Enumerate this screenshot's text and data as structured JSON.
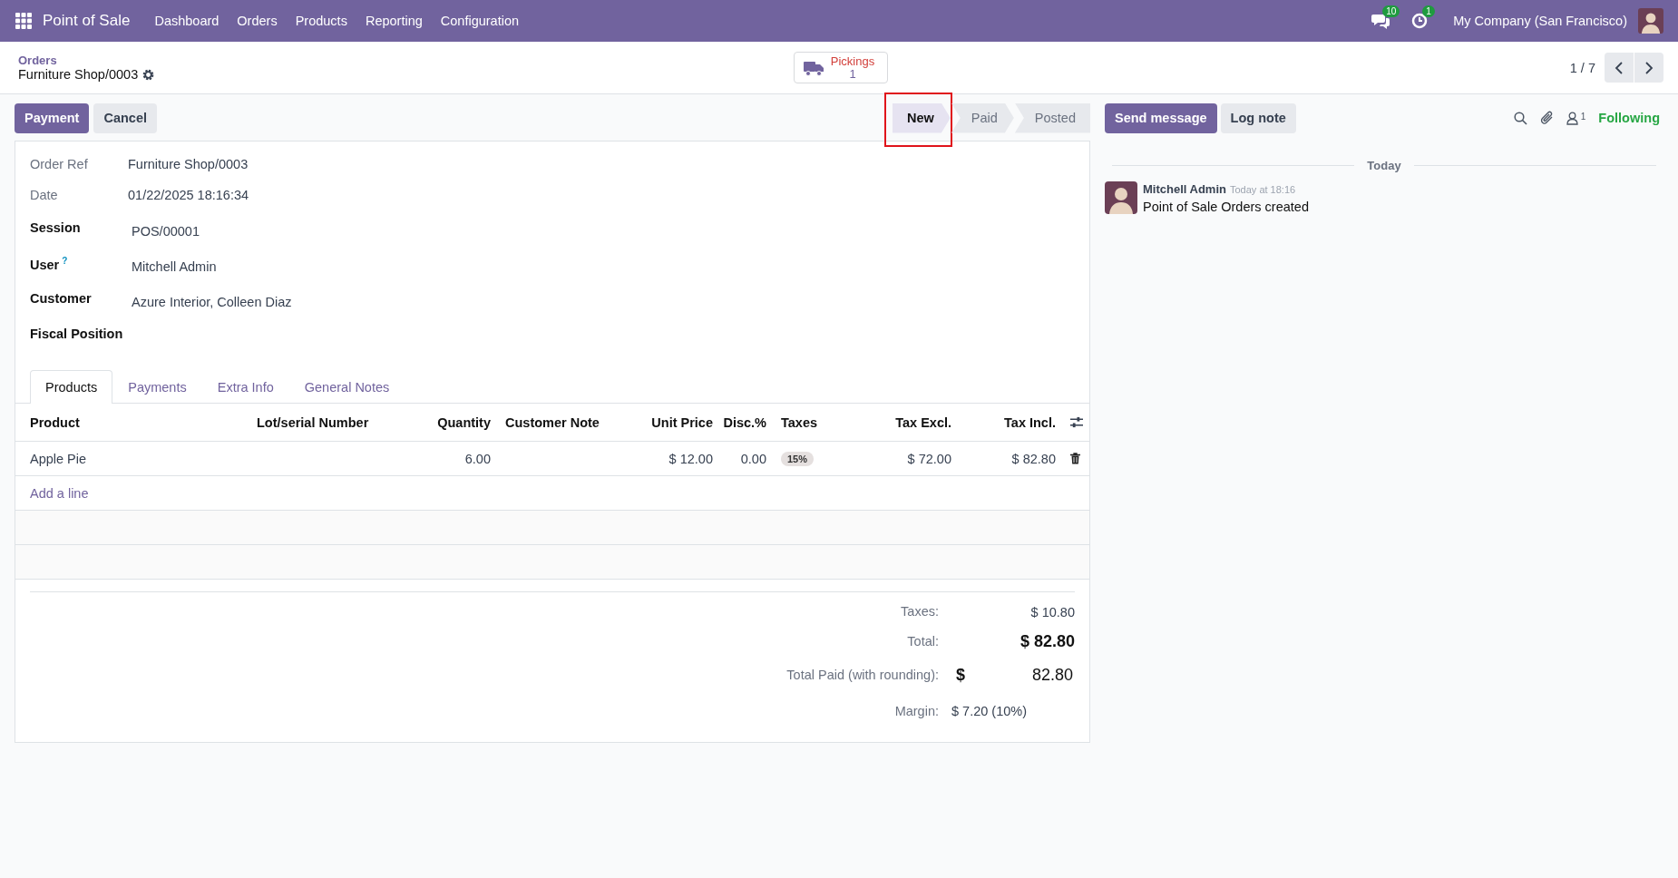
{
  "navbar": {
    "app_title": "Point of Sale",
    "menu": [
      "Dashboard",
      "Orders",
      "Products",
      "Reporting",
      "Configuration"
    ],
    "messages_badge": "10",
    "activities_badge": "1",
    "company": "My Company (San Francisco)"
  },
  "breadcrumb": {
    "parent": "Orders",
    "current": "Furniture Shop/0003"
  },
  "smart_button": {
    "label": "Pickings",
    "count": "1"
  },
  "pager": {
    "value": "1 / 7"
  },
  "actions": [
    {
      "label": "Payment",
      "kind": "primary"
    },
    {
      "label": "Cancel",
      "kind": "secondary"
    }
  ],
  "status_steps": [
    {
      "label": "New",
      "selected": true,
      "highlighted": true
    },
    {
      "label": "Paid",
      "selected": false,
      "highlighted": false
    },
    {
      "label": "Posted",
      "selected": false,
      "highlighted": false
    }
  ],
  "fields": [
    {
      "label": "Order Ref",
      "value": "Furniture Shop/0003",
      "kind": "readonly"
    },
    {
      "label": "Date",
      "value": "01/22/2025 18:16:34",
      "kind": "readonly"
    },
    {
      "label": "Session",
      "value": "POS/00001",
      "kind": "editable"
    },
    {
      "label": "User",
      "help": "?",
      "value": "Mitchell Admin",
      "kind": "editable"
    },
    {
      "label": "Customer",
      "value": "Azure Interior, Colleen Diaz",
      "kind": "editable"
    },
    {
      "label": "Fiscal Position",
      "kind": "editable"
    }
  ],
  "tabs": [
    {
      "label": "Products",
      "selected": true
    },
    {
      "label": "Payments",
      "selected": false
    },
    {
      "label": "Extra Info",
      "selected": false
    },
    {
      "label": "General Notes",
      "selected": false
    }
  ],
  "table": {
    "columns": [
      "Product",
      "Lot/serial Number",
      "Quantity",
      "Customer Note",
      "Unit Price",
      "Disc.%",
      "Taxes",
      "Tax Excl.",
      "Tax Incl."
    ],
    "rows": [
      {
        "product": "Apple Pie",
        "quantity": "6.00",
        "unit_price": "$ 12.00",
        "discount": "0.00",
        "taxes": [
          "15%"
        ],
        "tax_excl": "$ 72.00",
        "tax_incl": "$ 82.80"
      }
    ],
    "add_line": "Add a line"
  },
  "totals": [
    {
      "label": "Taxes:",
      "value": "$ 10.80",
      "kind": "plain"
    },
    {
      "label": "Total:",
      "value": "$ 82.80",
      "kind": "grand"
    },
    {
      "label": "Total Paid (with rounding):",
      "currency": "$",
      "amount": "82.80",
      "kind": "split"
    },
    {
      "label": "Margin:",
      "value": "$ 7.20 (10%)",
      "kind": "left"
    }
  ],
  "chatter": {
    "buttons": [
      {
        "label": "Send message",
        "kind": "primary"
      },
      {
        "label": "Log note",
        "kind": "secondary"
      }
    ],
    "followers_count": "1",
    "follow_label": "Following",
    "date_separator": "Today",
    "messages": [
      {
        "author": "Mitchell Admin",
        "time": "Today at 18:16",
        "body": "Point of Sale Orders created"
      }
    ]
  }
}
